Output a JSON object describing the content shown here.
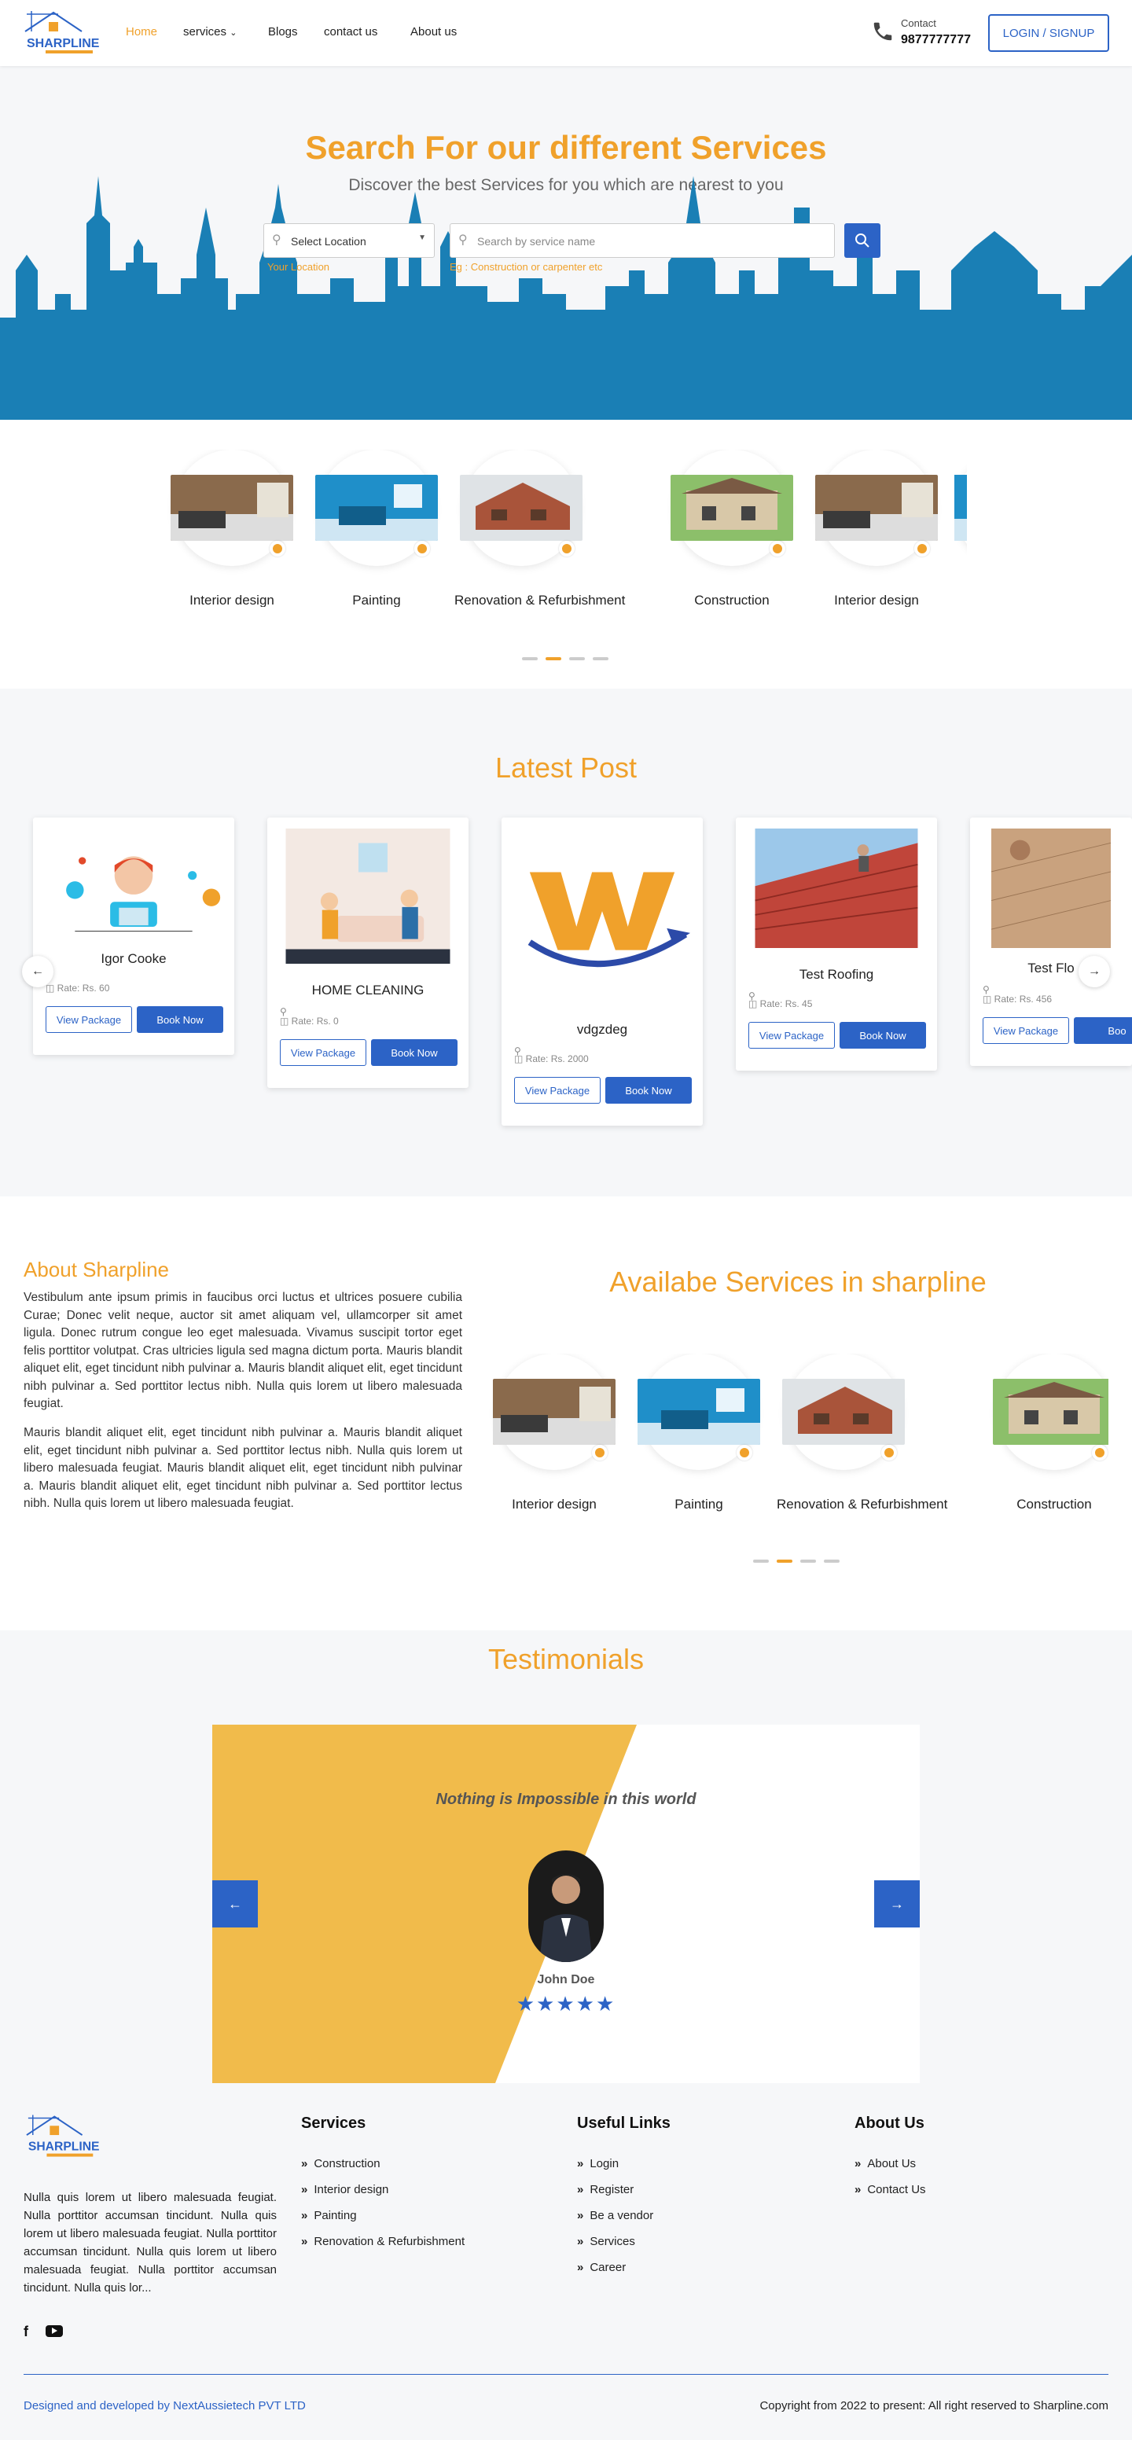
{
  "header": {
    "logo_text": "SHARPLINE",
    "nav": [
      {
        "label": "Home",
        "active": true
      },
      {
        "label": "services",
        "has_dropdown": true
      },
      {
        "label": "Blogs"
      },
      {
        "label": "contact us"
      },
      {
        "label": "About us"
      }
    ],
    "contact_label": "Contact",
    "contact_number": "9877777777",
    "login_label": "LOGIN / SIGNUP"
  },
  "hero": {
    "title": "Search For our different Services",
    "subtitle": "Discover the best Services for you which are nearest to you",
    "location_select": "Select Location",
    "location_hint": "Your Location",
    "search_placeholder": "Search by service name",
    "search_hint": "Eg : Construction or carpenter etc"
  },
  "services_carousel": {
    "items": [
      {
        "label": "Interior design",
        "icon": "interior-photo"
      },
      {
        "label": "Painting",
        "icon": "painting-photo"
      },
      {
        "label": "Renovation & Refurbishment",
        "icon": "renovation-photo"
      },
      {
        "label": "Construction",
        "icon": "construction-photo"
      },
      {
        "label": "Interior design",
        "icon": "interior-photo"
      }
    ],
    "active_dot": 1,
    "dot_count": 4
  },
  "latest": {
    "title": "Latest Post",
    "cards": [
      {
        "title": "Igor Cooke",
        "rate": "Rate: Rs. 60",
        "view": "View Package",
        "book": "Book Now"
      },
      {
        "title": "HOME CLEANING",
        "rate": "Rate: Rs. 0",
        "view": "View Package",
        "book": "Book Now"
      },
      {
        "title": "vdgzdeg",
        "rate": "Rate: Rs. 2000",
        "view": "View Package",
        "book": "Book Now"
      },
      {
        "title": "Test Roofing",
        "rate": "Rate: Rs. 45",
        "view": "View Package",
        "book": "Book Now"
      },
      {
        "title": "Test Flo",
        "rate": "Rate: Rs. 456",
        "view": "View Package",
        "book": "Boo"
      }
    ]
  },
  "about": {
    "title": "About Sharpline",
    "p1": "Vestibulum ante ipsum primis in faucibus orci luctus et ultrices posuere cubilia Curae; Donec velit neque, auctor sit amet aliquam vel, ullamcorper sit amet ligula. Donec rutrum congue leo eget malesuada. Vivamus suscipit tortor eget felis porttitor volutpat. Cras ultricies ligula sed magna dictum porta. Mauris blandit aliquet elit, eget tincidunt nibh pulvinar a. Mauris blandit aliquet elit, eget tincidunt nibh pulvinar a. Sed porttitor lectus nibh. Nulla quis lorem ut libero malesuada feugiat.",
    "p2": "Mauris blandit aliquet elit, eget tincidunt nibh pulvinar a. Mauris blandit aliquet elit, eget tincidunt nibh pulvinar a. Sed porttitor lectus nibh. Nulla quis lorem ut libero malesuada feugiat. Mauris blandit aliquet elit, eget tincidunt nibh pulvinar a. Mauris blandit aliquet elit, eget tincidunt nibh pulvinar a. Sed porttitor lectus nibh. Nulla quis lorem ut libero malesuada feugiat."
  },
  "available": {
    "title": "Availabe Services in sharpline",
    "items": [
      {
        "label": "Interior design"
      },
      {
        "label": "Painting"
      },
      {
        "label": "Renovation & Refurbishment"
      },
      {
        "label": "Construction"
      }
    ],
    "active_dot": 1,
    "dot_count": 4
  },
  "testimonials": {
    "title": "Testimonials",
    "quote": "Nothing is Impossible in this world",
    "name": "John Doe",
    "stars": 5
  },
  "footer": {
    "about_text": "Nulla quis lorem ut libero malesuada feugiat. Nulla porttitor accumsan tincidunt. Nulla quis lorem ut libero malesuada feugiat. Nulla porttitor accumsan tincidunt. Nulla quis lorem ut libero malesuada feugiat. Nulla porttitor accumsan tincidunt. Nulla quis lor...",
    "services_title": "Services",
    "services": [
      "Construction",
      "Interior design",
      "Painting",
      "Renovation & Refurbishment"
    ],
    "links_title": "Useful Links",
    "links": [
      "Login",
      "Register",
      "Be a vendor",
      "Services",
      "Career"
    ],
    "about_title": "About Us",
    "about_links": [
      "About Us",
      "Contact Us"
    ],
    "designed": "Designed and developed by NextAussietech PVT LTD",
    "copyright": "Copyright from 2022 to present: All right reserved to Sharpline.com"
  },
  "colors": {
    "accent": "#f0a12b",
    "primary": "#2c63c6",
    "skyline": "#1a7fb5"
  }
}
